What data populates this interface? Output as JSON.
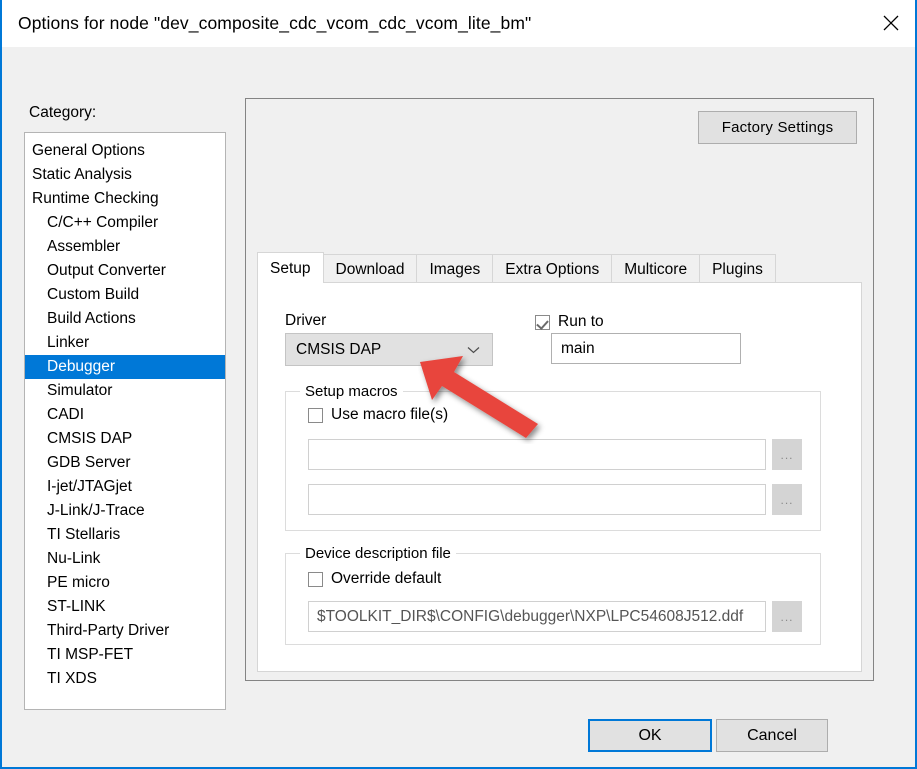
{
  "window": {
    "title": "Options for node \"dev_composite_cdc_vcom_cdc_vcom_lite_bm\"",
    "close_icon": "close-icon",
    "accent_color": "#0078d7"
  },
  "category": {
    "label": "Category:",
    "selected": "Debugger",
    "items": [
      {
        "label": "General Options",
        "indent": false,
        "selected": false
      },
      {
        "label": "Static Analysis",
        "indent": false,
        "selected": false
      },
      {
        "label": "Runtime Checking",
        "indent": false,
        "selected": false
      },
      {
        "label": "C/C++ Compiler",
        "indent": true,
        "selected": false
      },
      {
        "label": "Assembler",
        "indent": true,
        "selected": false
      },
      {
        "label": "Output Converter",
        "indent": true,
        "selected": false
      },
      {
        "label": "Custom Build",
        "indent": true,
        "selected": false
      },
      {
        "label": "Build Actions",
        "indent": true,
        "selected": false
      },
      {
        "label": "Linker",
        "indent": true,
        "selected": false
      },
      {
        "label": "Debugger",
        "indent": true,
        "selected": true
      },
      {
        "label": "Simulator",
        "indent": true,
        "selected": false
      },
      {
        "label": "CADI",
        "indent": true,
        "selected": false
      },
      {
        "label": "CMSIS DAP",
        "indent": true,
        "selected": false
      },
      {
        "label": "GDB Server",
        "indent": true,
        "selected": false
      },
      {
        "label": "I-jet/JTAGjet",
        "indent": true,
        "selected": false
      },
      {
        "label": "J-Link/J-Trace",
        "indent": true,
        "selected": false
      },
      {
        "label": "TI Stellaris",
        "indent": true,
        "selected": false
      },
      {
        "label": "Nu-Link",
        "indent": true,
        "selected": false
      },
      {
        "label": "PE micro",
        "indent": true,
        "selected": false
      },
      {
        "label": "ST-LINK",
        "indent": true,
        "selected": false
      },
      {
        "label": "Third-Party Driver",
        "indent": true,
        "selected": false
      },
      {
        "label": "TI MSP-FET",
        "indent": true,
        "selected": false
      },
      {
        "label": "TI XDS",
        "indent": true,
        "selected": false
      }
    ]
  },
  "panel": {
    "factory_settings_label": "Factory Settings",
    "tabs": [
      {
        "label": "Setup",
        "active": true
      },
      {
        "label": "Download",
        "active": false
      },
      {
        "label": "Images",
        "active": false
      },
      {
        "label": "Extra Options",
        "active": false
      },
      {
        "label": "Multicore",
        "active": false
      },
      {
        "label": "Plugins",
        "active": false
      }
    ]
  },
  "setup": {
    "driver_label": "Driver",
    "driver_value": "CMSIS DAP",
    "driver_chevron": "chevron-down-icon",
    "run_to_label": "Run to",
    "run_to_checked": true,
    "run_to_value": "main",
    "setup_macros": {
      "title": "Setup macros",
      "use_macro_label": "Use macro file(s)",
      "use_macro_checked": false,
      "macro_file_1": "",
      "macro_file_2": "",
      "browse_label": "..."
    },
    "device_description": {
      "title": "Device description file",
      "override_label": "Override default",
      "override_checked": false,
      "path_value": "$TOOLKIT_DIR$\\CONFIG\\debugger\\NXP\\LPC54608J512.ddf",
      "browse_label": "..."
    }
  },
  "footer": {
    "ok_label": "OK",
    "cancel_label": "Cancel"
  },
  "annotation": {
    "arrow_color": "#e8453c",
    "points_to": "driver-dropdown"
  }
}
